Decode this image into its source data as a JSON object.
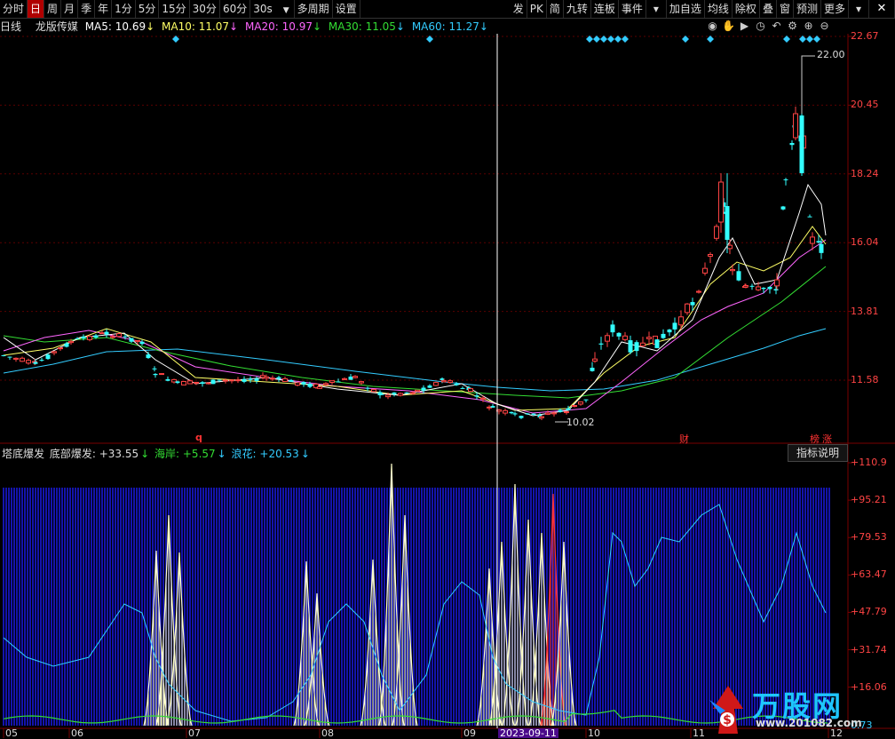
{
  "toolbar": {
    "left_items": [
      "分时",
      "日",
      "周",
      "月",
      "季",
      "年",
      "1分",
      "5分",
      "15分",
      "30分",
      "60分"
    ],
    "active_index": 1,
    "period_select": "30s",
    "more_items": [
      "多周期",
      "设置"
    ],
    "right_items": [
      "发",
      "PK",
      "简",
      "九转",
      "连板",
      "事件"
    ],
    "right_items2": [
      "加自选",
      "均线",
      "除权",
      "叠",
      "窗",
      "预测",
      "更多"
    ],
    "close_glyph": "✕"
  },
  "info": {
    "period": "日线",
    "stock_name": "龙版传媒",
    "ma5": "MA5: 10.69",
    "ma10": "MA10: 11.07",
    "ma20": "MA20: 10.97",
    "ma30": "MA30: 11.05",
    "ma60": "MA60: 11.27",
    "colors": {
      "ma5": "#ffffff",
      "ma10": "#ffff66",
      "ma20": "#ff66ff",
      "ma30": "#33dd33",
      "ma60": "#33ccff"
    }
  },
  "price_axis": [
    "22.67",
    "20.45",
    "18.24",
    "16.04",
    "13.81",
    "11.58"
  ],
  "price_high_label": "22.00",
  "price_low_label": "10.02",
  "event_markers": {
    "q": "q",
    "cai": "财",
    "bang": "榜",
    "zhang": "涨"
  },
  "indicator": {
    "name": "塔底爆发",
    "line1": "底部爆发: +33.55",
    "line2": "海岸: +5.57",
    "line3": "浪花: +20.53",
    "help_button": "指标说明"
  },
  "indicator_axis": [
    "110.9",
    "95.21",
    "79.53",
    "63.47",
    "47.79",
    "31.74",
    "16.06"
  ],
  "indicator_bottom_label": "0.73",
  "x_axis": {
    "months": [
      "05",
      "06",
      "07",
      "08",
      "09",
      "10",
      "11",
      "12"
    ],
    "crosshair_date": "2023-09-11"
  },
  "toolbar_icons": [
    "eye-icon",
    "hand-icon",
    "play-icon",
    "clock-icon",
    "undo-icon",
    "settings-icon",
    "plus-icon",
    "minus-icon"
  ],
  "logo": {
    "text": "万股网",
    "url": "www.201082.com"
  }
}
